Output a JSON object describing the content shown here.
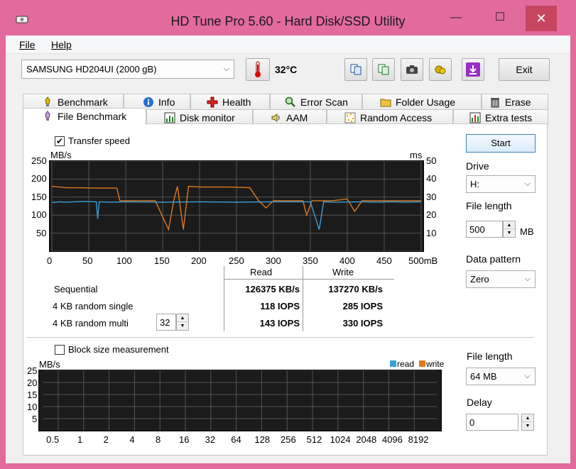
{
  "window": {
    "title": "HD Tune Pro 5.60 - Hard Disk/SSD Utility",
    "minimize": "—",
    "maximize": "☐",
    "close": "✕"
  },
  "menu": [
    {
      "label": "File"
    },
    {
      "label": "Help"
    }
  ],
  "toolbar": {
    "drive": "SAMSUNG HD204UI (2000 gB)",
    "temperature": "32°C",
    "exit_label": "Exit"
  },
  "tabs_row1": [
    {
      "label": "Benchmark",
      "icon": "benchmark-icon"
    },
    {
      "label": "Info",
      "icon": "info-icon"
    },
    {
      "label": "Health",
      "icon": "health-icon"
    },
    {
      "label": "Error Scan",
      "icon": "error-scan-icon"
    },
    {
      "label": "Folder Usage",
      "icon": "folder-icon"
    },
    {
      "label": "Erase",
      "icon": "erase-icon"
    }
  ],
  "tabs_row2": [
    {
      "label": "File Benchmark",
      "icon": "file-benchmark-icon",
      "active": true
    },
    {
      "label": "Disk monitor",
      "icon": "disk-monitor-icon"
    },
    {
      "label": "AAM",
      "icon": "speaker-icon"
    },
    {
      "label": "Random Access",
      "icon": "random-access-icon"
    },
    {
      "label": "Extra tests",
      "icon": "extra-tests-icon"
    }
  ],
  "transfer": {
    "checkbox_label": "Transfer speed",
    "checked": true,
    "y_unit_left": "MB/s",
    "y_unit_right": "ms",
    "y_ticks_left": [
      "250",
      "200",
      "150",
      "100",
      "50"
    ],
    "y_ticks_right": [
      "50",
      "40",
      "30",
      "20",
      "10"
    ],
    "x_ticks": [
      "0",
      "50",
      "100",
      "150",
      "200",
      "250",
      "300",
      "350",
      "400",
      "450",
      "500mB"
    ]
  },
  "results": {
    "col_read": "Read",
    "col_write": "Write",
    "rows": [
      {
        "label": "Sequential",
        "read": "126375 KB/s",
        "write": "137270 KB/s"
      },
      {
        "label": "4 KB random single",
        "read": "118 IOPS",
        "write": "285 IOPS"
      },
      {
        "label": "4 KB random multi",
        "read": "143 IOPS",
        "write": "330 IOPS"
      }
    ],
    "queue_depth": "32"
  },
  "block": {
    "checkbox_label": "Block size measurement",
    "checked": false,
    "y_unit": "MB/s",
    "legend_read": "read",
    "legend_write": "write",
    "y_ticks": [
      "25",
      "20",
      "15",
      "10",
      "5"
    ],
    "x_ticks": [
      "0.5",
      "1",
      "2",
      "4",
      "8",
      "16",
      "32",
      "64",
      "128",
      "256",
      "512",
      "1024",
      "2048",
      "4096",
      "8192"
    ]
  },
  "right_panel": {
    "start_label": "Start",
    "drive_label": "Drive",
    "drive_value": "H:",
    "file_length_label": "File length",
    "file_length_value": "500",
    "file_length_unit": "MB",
    "data_pattern_label": "Data pattern",
    "data_pattern_value": "Zero",
    "block_file_length_label": "File length",
    "block_file_length_value": "64 MB",
    "delay_label": "Delay",
    "delay_value": "0"
  },
  "colors": {
    "read": "#3aa0d8",
    "write": "#e07a1c",
    "graph_bg": "#1b1b1b",
    "grid": "#555555",
    "frame": "#e26a9c"
  },
  "chart_data": [
    {
      "type": "line",
      "xlabel": "",
      "ylabel": "MB/s",
      "y2label": "ms",
      "xlim": [
        0,
        500
      ],
      "ylim": [
        0,
        250
      ],
      "y2lim": [
        0,
        50
      ],
      "grid": true,
      "series": [
        {
          "name": "",
          "axis": "left",
          "color": "#e07a1c",
          "x": [
            0,
            10,
            20,
            40,
            60,
            80,
            88,
            92,
            100,
            140,
            158,
            165,
            170,
            178,
            185,
            200,
            240,
            268,
            280,
            290,
            300,
            340,
            345,
            352,
            360,
            380,
            400,
            410,
            420,
            440,
            460,
            480,
            500
          ],
          "y": [
            180,
            178,
            176,
            176,
            175,
            175,
            175,
            140,
            140,
            140,
            60,
            140,
            180,
            60,
            180,
            178,
            178,
            176,
            140,
            120,
            140,
            140,
            100,
            140,
            140,
            140,
            145,
            110,
            140,
            140,
            140,
            140,
            140
          ]
        },
        {
          "name": "",
          "axis": "left",
          "color": "#3aa0d8",
          "x": [
            0,
            10,
            20,
            40,
            60,
            62,
            64,
            80,
            100,
            150,
            200,
            250,
            300,
            350,
            362,
            368,
            380,
            420,
            440,
            460,
            480,
            500
          ],
          "y": [
            135,
            137,
            136,
            138,
            137,
            90,
            137,
            136,
            137,
            136,
            137,
            136,
            137,
            137,
            60,
            137,
            136,
            137,
            136,
            137,
            136,
            137
          ]
        }
      ]
    },
    {
      "type": "line",
      "ylabel": "MB/s",
      "categories": [
        "0.5",
        "1",
        "2",
        "4",
        "8",
        "16",
        "32",
        "64",
        "128",
        "256",
        "512",
        "1024",
        "2048",
        "4096",
        "8192"
      ],
      "ylim": [
        0,
        25
      ],
      "grid": true,
      "legend": "top-right",
      "series": [
        {
          "name": "read",
          "values": []
        },
        {
          "name": "write",
          "values": []
        }
      ]
    }
  ]
}
